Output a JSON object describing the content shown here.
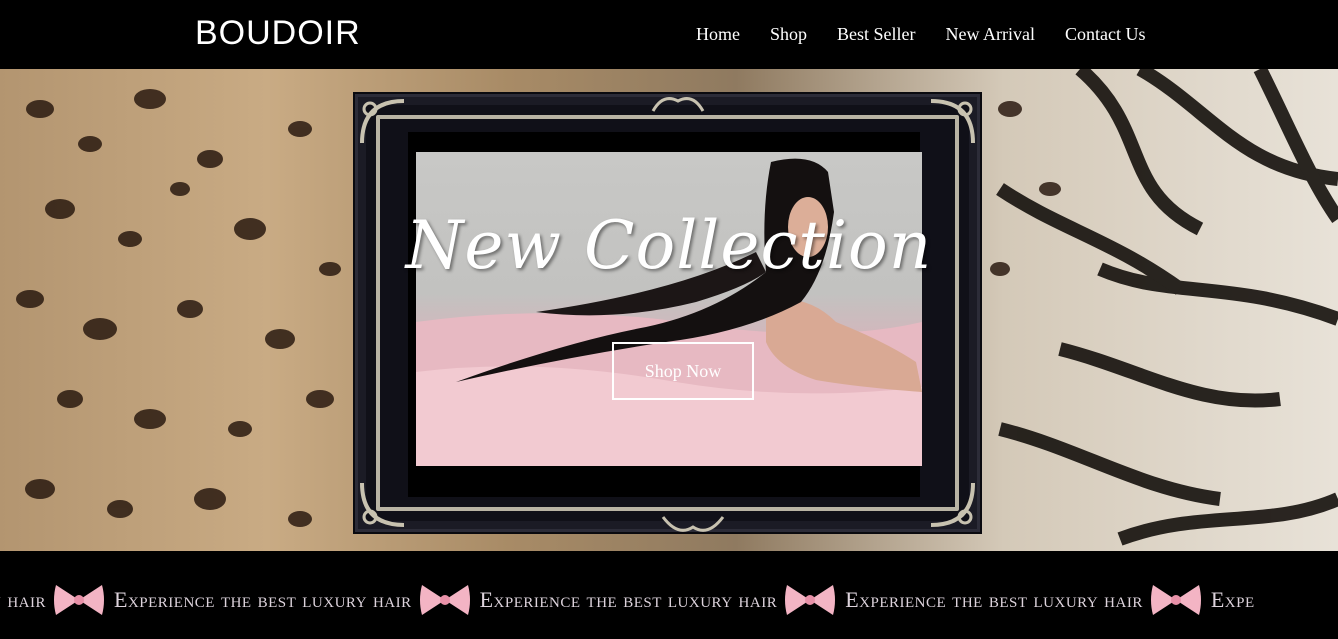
{
  "header": {
    "logo": "BOUDOIR",
    "nav": [
      "Home",
      "Shop",
      "Best Seller",
      "New Arrival",
      "Contact Us"
    ]
  },
  "hero": {
    "title": "New Collection",
    "cta": "Shop Now"
  },
  "marquee": {
    "text": "Experience the best luxury hair",
    "leading_fragment": "y hair",
    "trailing_fragment": "Expe"
  },
  "colors": {
    "background": "#000000",
    "bow": "#f3b4c4",
    "marquee_text": "#ddd3dc"
  }
}
